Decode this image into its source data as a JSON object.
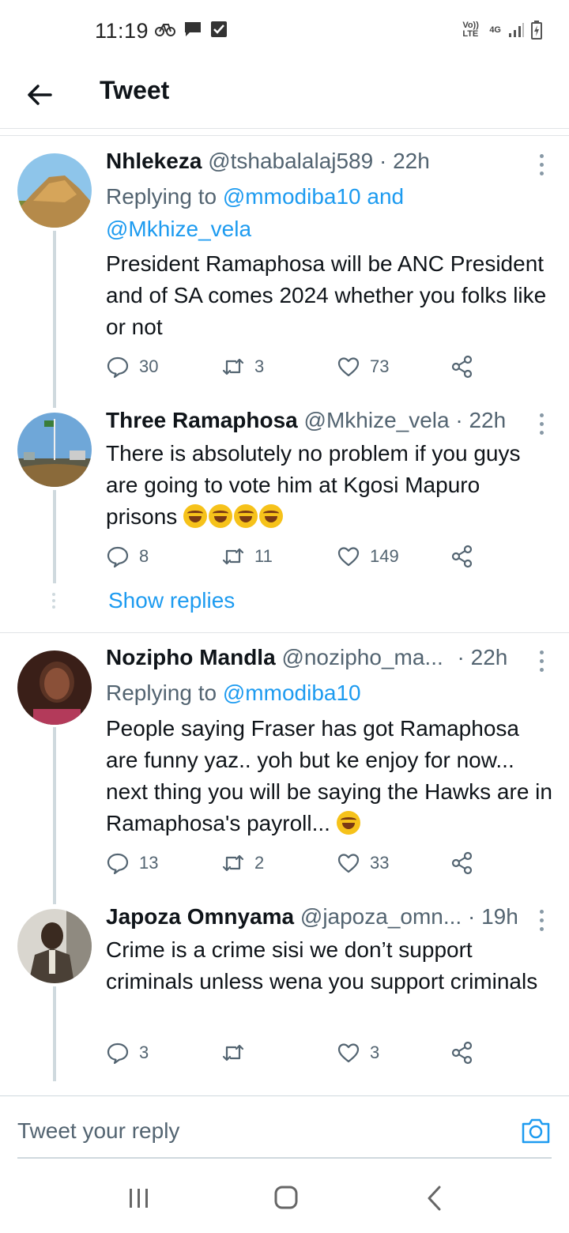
{
  "status_bar": {
    "time": "11:19",
    "network": "4G",
    "volte": "Vo)) LTE"
  },
  "header": {
    "title": "Tweet"
  },
  "tweets": [
    {
      "name": "Nhlekeza",
      "handle": "@tshabalalaj589",
      "time": "· 22h",
      "replying_prefix": "Replying to ",
      "replying_to": "@mmodiba10 and",
      "replying_to2": "@Mkhize_vela",
      "text": "President Ramaphosa will be ANC President and of SA comes 2024 whether you folks like or not",
      "replies": "30",
      "retweets": "3",
      "likes": "73"
    },
    {
      "name": "Three Ramaphosa",
      "handle": "@Mkhize_vela",
      "time": "· 22h",
      "text": "There is absolutely no problem if you guys are going to vote him at Kgosi Mapuro prisons",
      "emoji_count": 4,
      "replies": "8",
      "retweets": "11",
      "likes": "149"
    },
    {
      "name": "Nozipho Mandla",
      "handle": "@nozipho_ma...",
      "time": "· 22h",
      "replying_prefix": "Replying to ",
      "replying_to": "@mmodiba10",
      "text": "People saying Fraser has got Ramaphosa are funny yaz.. yoh but ke enjoy for now... next thing you will be saying the Hawks are in Ramaphosa's payroll...",
      "emoji_count": 1,
      "replies": "13",
      "retweets": "2",
      "likes": "33"
    },
    {
      "name": "Japoza Omnyama",
      "handle": "@japoza_omn...",
      "time": "· 19h",
      "text": "Crime is a crime sisi we don’t support criminals unless wena you support criminals",
      "replies": "3",
      "retweets": "",
      "likes": "3"
    }
  ],
  "show_replies_label": "Show replies",
  "composer": {
    "placeholder": "Tweet your reply"
  },
  "colors": {
    "accent": "#1d9bf0",
    "muted": "#536471",
    "line": "#cfd9de"
  }
}
